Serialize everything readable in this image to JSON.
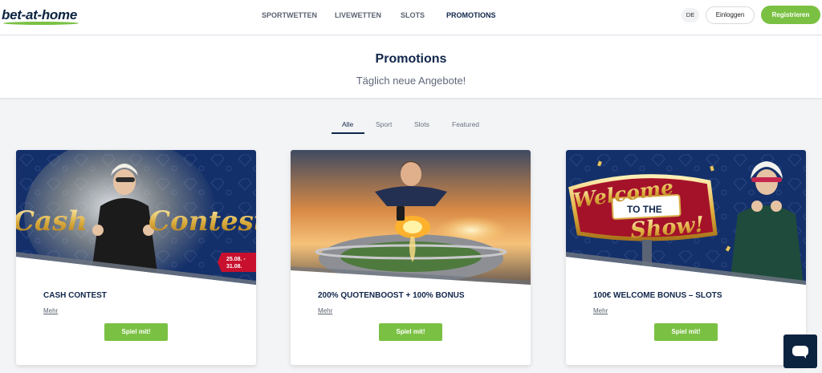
{
  "brand": {
    "logo_text": "bet-at-home"
  },
  "nav": {
    "items": [
      {
        "label": "SPORTWETTEN",
        "active": false
      },
      {
        "label": "LIVEWETTEN",
        "active": false
      },
      {
        "label": "SLOTS",
        "active": false
      },
      {
        "label": "PROMOTIONS",
        "active": true
      }
    ]
  },
  "header_actions": {
    "language": "DE",
    "login_label": "Einloggen",
    "register_label": "Registrieren"
  },
  "hero": {
    "title": "Promotions",
    "subtitle": "Täglich neue Angebote!"
  },
  "filters": {
    "tabs": [
      {
        "label": "Alle",
        "active": true
      },
      {
        "label": "Sport",
        "active": false
      },
      {
        "label": "Slots",
        "active": false
      },
      {
        "label": "Featured",
        "active": false
      }
    ]
  },
  "cards": [
    {
      "title": "CASH CONTEST",
      "more_label": "Mehr",
      "cta_label": "Spiel mit!",
      "image": {
        "headline_left": "Cash",
        "headline_right": "Contest",
        "date_from": "25.08. -",
        "date_to": "31.08."
      }
    },
    {
      "title": "200% QUOTENBOOST + 100% BONUS",
      "more_label": "Mehr",
      "cta_label": "Spiel mit!",
      "image": {}
    },
    {
      "title": "100€ WELCOME BONUS – SLOTS",
      "more_label": "Mehr",
      "cta_label": "Spiel mit!",
      "image": {
        "sign_line1": "Welcome",
        "sign_line2": "TO THE",
        "sign_line3": "Show!"
      }
    }
  ],
  "colors": {
    "brand_navy": "#10264a",
    "brand_green": "#7ac143",
    "page_bg": "#f3f4f6"
  },
  "icons": {
    "chat": "chat-bubble-icon"
  }
}
